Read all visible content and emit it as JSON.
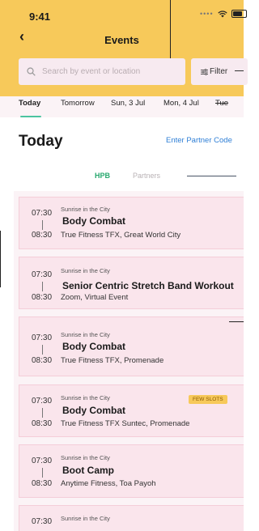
{
  "status_bar": {
    "time": "9:41"
  },
  "header": {
    "back_icon": "chevron-left-icon",
    "title": "Events"
  },
  "search": {
    "placeholder": "Search by event or location",
    "value": ""
  },
  "filter": {
    "label": "Filter"
  },
  "date_tabs": [
    {
      "label": "Today",
      "active": true
    },
    {
      "label": "Tomorrow",
      "active": false
    },
    {
      "label": "Sun, 3 Jul",
      "active": false
    },
    {
      "label": "Mon, 4 Jul",
      "active": false
    },
    {
      "label": "Tue",
      "active": false
    }
  ],
  "section": {
    "title": "Today",
    "partner_code": "Enter Partner Code"
  },
  "segments": [
    {
      "label": "HPB",
      "active": true
    },
    {
      "label": "Partners",
      "active": false
    }
  ],
  "events": [
    {
      "start": "07:30",
      "end": "08:30",
      "series": "Sunrise in the City",
      "name": "Body Combat",
      "location": "True Fitness TFX, Great World City"
    },
    {
      "start": "07:30",
      "end": "08:30",
      "series": "Sunrise in the City",
      "name": "Senior Centric Stretch Band Workout",
      "location": "Zoom, Virtual Event"
    },
    {
      "start": "07:30",
      "end": "08:30",
      "series": "Sunrise in the City",
      "name": "Body Combat",
      "location": "True Fitness TFX, Promenade"
    },
    {
      "start": "07:30",
      "end": "08:30",
      "series": "Sunrise in the City",
      "name": "Body Combat",
      "location": "True Fitness TFX Suntec, Promenade",
      "badge": "FEW SLOTS"
    },
    {
      "start": "07:30",
      "end": "08:30",
      "series": "Sunrise in the City",
      "name": "Boot Camp",
      "location": "Anytime Fitness, Toa Payoh"
    },
    {
      "start": "07:30",
      "series": "Sunrise in the City"
    }
  ],
  "colors": {
    "header_bg": "#f7c95a",
    "accent_green": "#27a86e",
    "link_blue": "#2f7fd6",
    "card_bg": "#fae5ec"
  }
}
